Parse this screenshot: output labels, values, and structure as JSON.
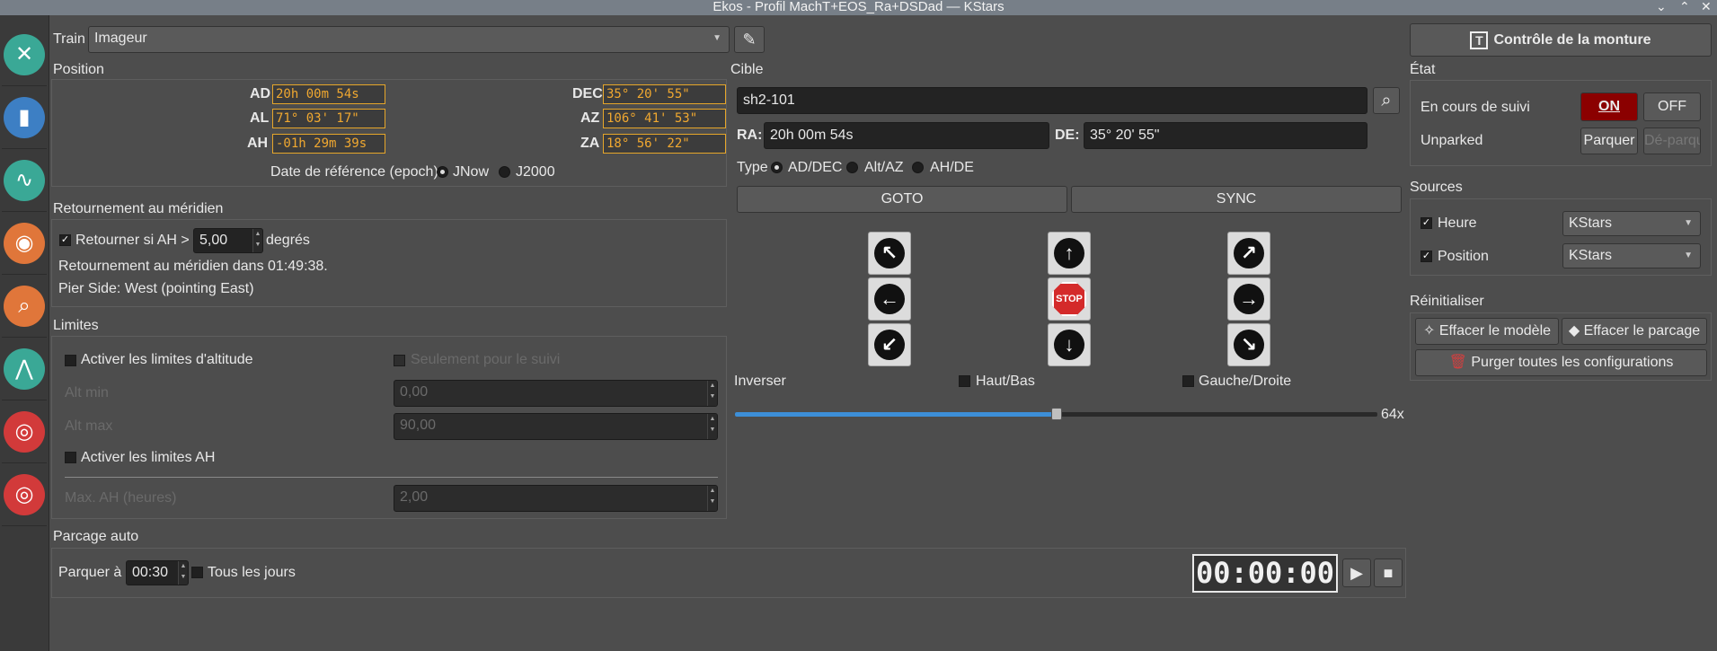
{
  "window": {
    "title": "Ekos - Profil MachT+EOS_Ra+DSDad — KStars",
    "controls": [
      "⌄",
      "⌃",
      "✕"
    ]
  },
  "sidebar": {
    "items": [
      {
        "name": "setup",
        "icon": "wrench-screwdriver-icon",
        "color": "#3aa896",
        "glyph": "✕"
      },
      {
        "name": "scheduler",
        "icon": "notebook-icon",
        "color": "#3d7fc4",
        "glyph": "▮"
      },
      {
        "name": "analyze",
        "icon": "chart-icon",
        "color": "#3aa896",
        "glyph": "∿"
      },
      {
        "name": "capture",
        "icon": "camera-icon",
        "color": "#e0763a",
        "glyph": "◉"
      },
      {
        "name": "focus",
        "icon": "magnifier-icon",
        "color": "#e0763a",
        "glyph": "⌕"
      },
      {
        "name": "mount",
        "icon": "tripod-icon",
        "color": "#3aa896",
        "glyph": "⋀"
      },
      {
        "name": "align",
        "icon": "target-icon",
        "color": "#d23a3a",
        "glyph": "◎"
      },
      {
        "name": "guide",
        "icon": "guide-target-icon",
        "color": "#d23a3a",
        "glyph": "◎"
      }
    ]
  },
  "train": {
    "label": "Train",
    "value": "Imageur"
  },
  "position": {
    "title": "Position",
    "ad_label": "AD",
    "ad": "20h 00m 54s",
    "al_label": "AL",
    "al": " 71° 03' 17\"",
    "ah_label": "AH",
    "ah": "-01h 29m 39s",
    "dec_label": "DEC",
    "dec": " 35° 20' 55\"",
    "az_label": "AZ",
    "az": " 106° 41' 53\"",
    "za_label": "ZA",
    "za": " 18° 56' 22\"",
    "epoch_label": "Date de référence (epoch)",
    "jnow": "JNow",
    "j2000": "J2000"
  },
  "meridian": {
    "title": "Retournement au méridien",
    "flip_label": "Retourner si AH >",
    "flip_value": "5,00",
    "unit": "degrés",
    "status": "Retournement au méridien dans 01:49:38.",
    "pier": "Pier Side: West (pointing East)"
  },
  "limits": {
    "title": "Limites",
    "alt_limits": "Activer les limites d'altitude",
    "tracking_only": "Seulement pour le suivi",
    "alt_min_label": "Alt min",
    "alt_min": "0,00",
    "alt_max_label": "Alt max",
    "alt_max": "90,00",
    "ah_limits": "Activer les limites AH",
    "max_ah_label": "Max. AH (heures)",
    "max_ah": "2,00"
  },
  "autopark": {
    "title": "Parcage auto",
    "park_at": "Parquer à",
    "time": "00:30",
    "every_day": "Tous les jours",
    "countdown": "00:00:00"
  },
  "target": {
    "title": "Cible",
    "name": "sh2-101",
    "ra_label": "RA:",
    "ra": "20h 00m 54s",
    "de_label": "DE:",
    "de": "35° 20' 55\"",
    "type_label": "Type",
    "type_addec": "AD/DEC",
    "type_altaz": "Alt/AZ",
    "type_ahde": "AH/DE",
    "goto": "GOTO",
    "sync": "SYNC"
  },
  "motion": {
    "stop": "STOP",
    "reverse_label": "Inverser",
    "updown": "Haut/Bas",
    "leftright": "Gauche/Droite",
    "speed": "64x",
    "speed_fraction": 0.5
  },
  "right": {
    "control_button": "Contrôle de la monture",
    "state_title": "État",
    "tracking_label": "En cours de suivi",
    "on": "ON",
    "off": "OFF",
    "unparked": "Unparked",
    "park": "Parquer",
    "unpark": "Dé-parquer",
    "sources_title": "Sources",
    "time_label": "Heure",
    "time_source": "KStars",
    "position_label": "Position",
    "position_source": "KStars",
    "reset_title": "Réinitialiser",
    "clear_model": "Effacer le modèle",
    "clear_park": "Effacer le parcage",
    "purge": "Purger toutes les configurations"
  },
  "colors": {
    "accent_on": "#8b0000",
    "lcd": "#f0a830",
    "slider": "#3d8fd8"
  }
}
